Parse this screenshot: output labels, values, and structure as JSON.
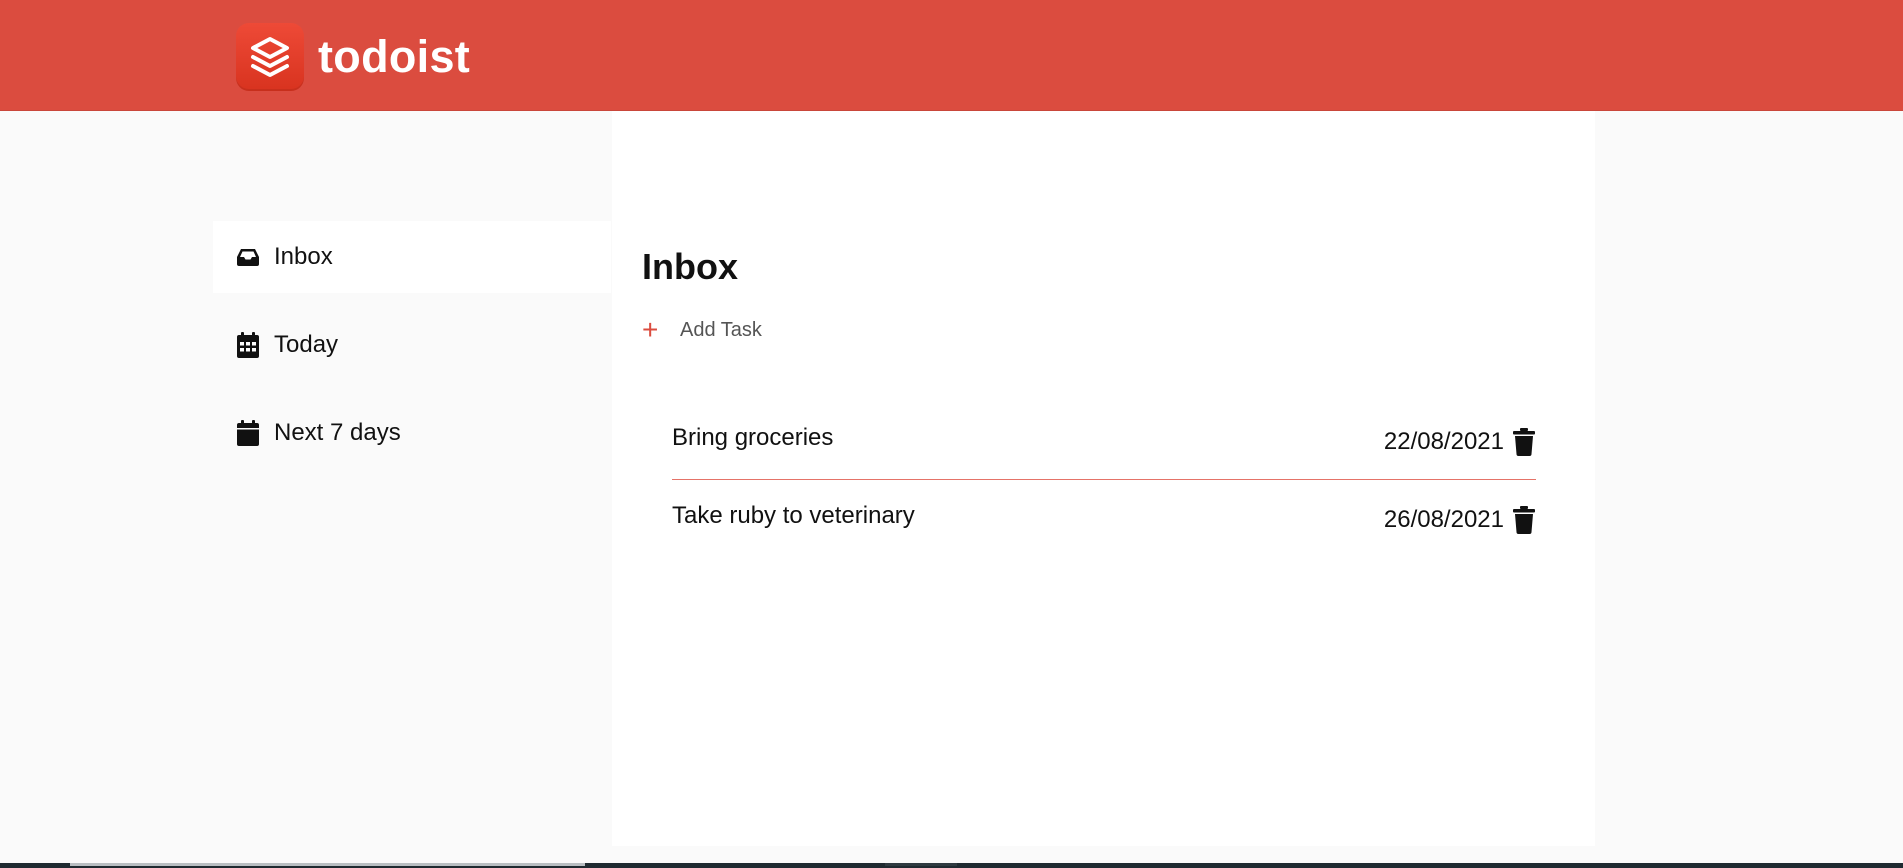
{
  "app": {
    "name": "todoist",
    "brand_color": "#db4c3f",
    "logo_icon": "todoist-layers-icon"
  },
  "sidebar": {
    "items": [
      {
        "label": "Inbox",
        "icon": "inbox-icon",
        "active": true
      },
      {
        "label": "Today",
        "icon": "calendar-grid-icon",
        "active": false
      },
      {
        "label": "Next 7 days",
        "icon": "calendar-icon",
        "active": false
      }
    ]
  },
  "main": {
    "title": "Inbox",
    "add_task_icon": "+",
    "add_task_label": "Add Task",
    "tasks": [
      {
        "title": "Bring groceries",
        "date": "22/08/2021",
        "icon": "trash-icon"
      },
      {
        "title": "Take ruby to veterinary",
        "date": "26/08/2021",
        "icon": "trash-icon"
      }
    ],
    "divider_color": "#e57368"
  }
}
